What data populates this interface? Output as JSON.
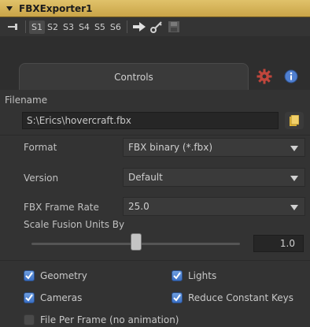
{
  "title": "FBXExporter1",
  "toolbar": {
    "slots": [
      "S1",
      "S2",
      "S3",
      "S4",
      "S5",
      "S6"
    ],
    "active_slot": "S1"
  },
  "tabs": {
    "controls_label": "Controls"
  },
  "filename": {
    "label": "Filename",
    "value": "S:\\Erics\\hovercraft.fbx"
  },
  "format": {
    "label": "Format",
    "value": "FBX binary (*.fbx)"
  },
  "version": {
    "label": "Version",
    "value": "Default"
  },
  "frame_rate": {
    "label": "FBX Frame Rate",
    "value": "25.0"
  },
  "scale": {
    "label": "Scale Fusion Units By",
    "value": "1.0",
    "slider_fraction": 0.5
  },
  "checkboxes": {
    "geometry": {
      "label": "Geometry",
      "checked": true
    },
    "lights": {
      "label": "Lights",
      "checked": true
    },
    "cameras": {
      "label": "Cameras",
      "checked": true
    },
    "reduce_keys": {
      "label": "Reduce Constant Keys",
      "checked": true
    },
    "file_per_frame": {
      "label": "File Per Frame (no animation)",
      "checked": false
    }
  },
  "colors": {
    "title_bar": "#d4b458",
    "check_on": "#4f85d6",
    "gear": "#c0463c",
    "info": "#4f7fd0"
  }
}
